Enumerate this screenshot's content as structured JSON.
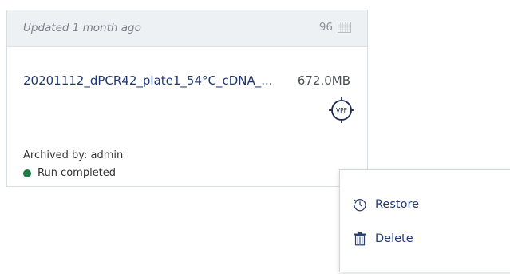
{
  "card": {
    "updated_text": "Updated 1 month ago",
    "well_count": "96",
    "filename": "20201112_dPCR42_plate1_54°C_cDNA_...",
    "filesize": "672.0MB",
    "file_badge": "VPF",
    "archived_by": "Archived by: admin",
    "status_text": "Run completed",
    "status_color": "#1e7d45"
  },
  "context_menu": {
    "items": [
      {
        "label": "Restore",
        "icon": "restore-icon"
      },
      {
        "label": "Delete",
        "icon": "trash-icon"
      }
    ]
  },
  "icons": {
    "plate": "plate-grid-icon",
    "vpf": "vpf-target-icon",
    "more": "more-dots-icon"
  }
}
